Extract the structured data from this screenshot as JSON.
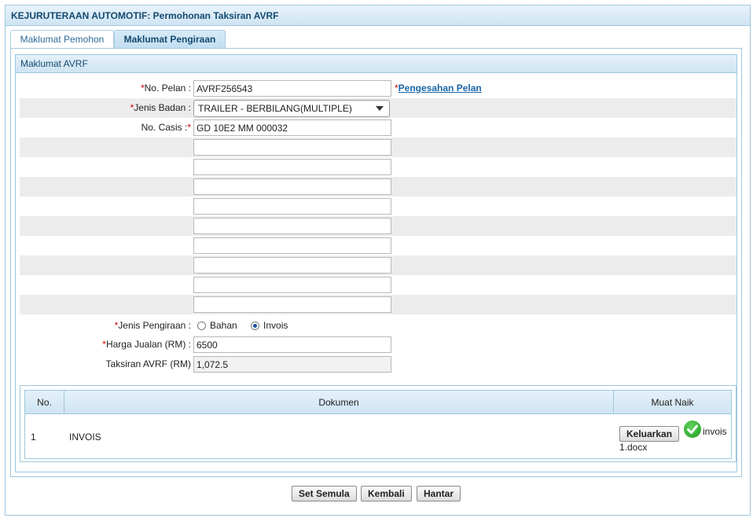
{
  "header": {
    "title": "KEJURUTERAAN AUTOMOTIF: Permohonan Taksiran AVRF"
  },
  "tabs": [
    {
      "label": "Maklumat Pemohon",
      "active": false
    },
    {
      "label": "Maklumat Pengiraan",
      "active": true
    }
  ],
  "section": {
    "title": "Maklumat AVRF"
  },
  "form": {
    "no_pelan": {
      "label": "No. Pelan :",
      "value": "AVRF256543"
    },
    "pengesahan_link": "Pengesahan Pelan",
    "jenis_badan": {
      "label": "Jenis Badan :",
      "value": "TRAILER - BERBILANG(MULTIPLE)"
    },
    "no_casis": {
      "label": "No. Casis :",
      "value": "GD 10E2 MM 000032"
    },
    "extra_fields": [
      "",
      "",
      "",
      "",
      "",
      "",
      "",
      "",
      ""
    ],
    "jenis_pengiraan": {
      "label": "Jenis Pengiraan :",
      "options": [
        "Bahan",
        "Invois"
      ],
      "selected": "Invois"
    },
    "harga_jualan": {
      "label": "Harga Jualan (RM) :",
      "value": "6500"
    },
    "taksiran": {
      "label": "Taksiran AVRF (RM)",
      "value": "1,072.5"
    }
  },
  "documents": {
    "headers": {
      "no": "No.",
      "dokumen": "Dokumen",
      "muat_naik": "Muat Naik"
    },
    "rows": [
      {
        "no": "1",
        "dokumen": "INVOIS",
        "button_label": "Keluarkan",
        "file_part1": "invois",
        "file_part2": "1.docx",
        "status_icon": "check-icon"
      }
    ]
  },
  "actions": {
    "reset_label": "Set Semula",
    "back_label": "Kembali",
    "submit_label": "Hantar"
  },
  "colors": {
    "required_asterisk": "#d40000",
    "header_text": "#144a6e",
    "link": "#1a66a8",
    "success_green": "#1f9a1f"
  }
}
